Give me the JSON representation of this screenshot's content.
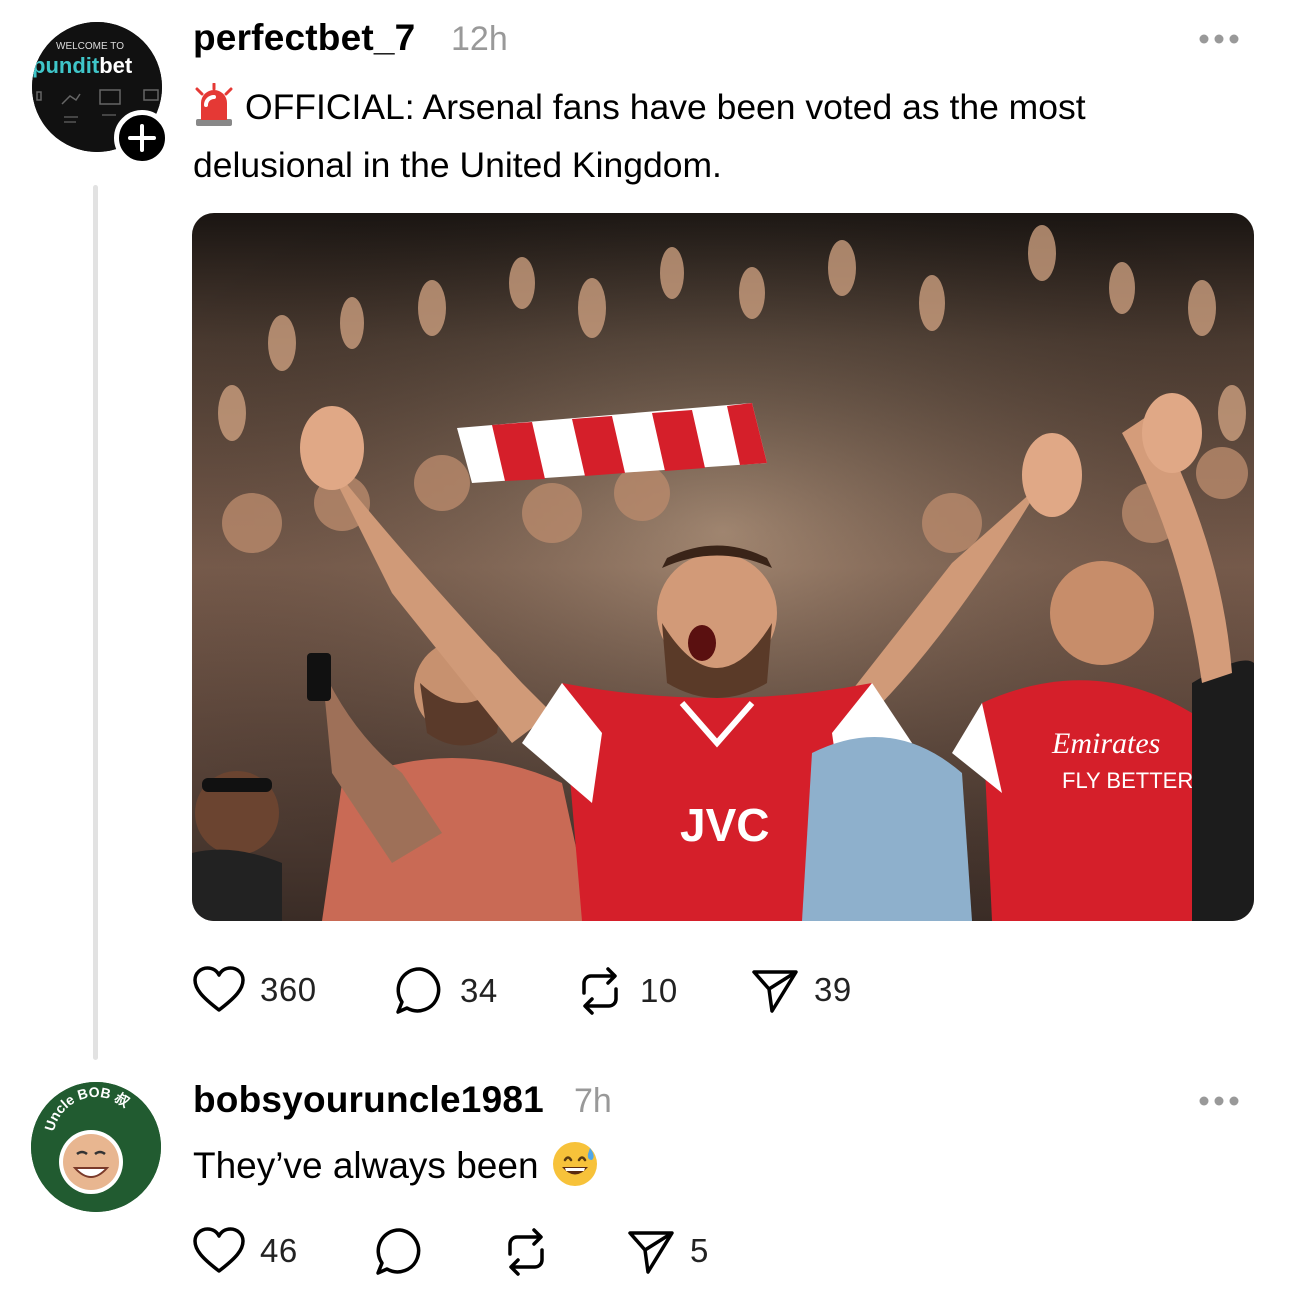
{
  "post": {
    "avatar": {
      "welcome": "WELCOME TO",
      "brand_part1": "pundit",
      "brand_part2": "bet",
      "icon": "punditbet-logo"
    },
    "username": "perfectbet_7",
    "time": "12h",
    "text": "OFFICIAL: Arsenal fans have been voted as the most delusional in the United Kingdom.",
    "emoji": "police-siren-emoji",
    "image": {
      "subject": "Arsenal fans cheering in stadium",
      "jersey_text": "JVC",
      "sponsor_text_1": "Emirates",
      "sponsor_text_2": "FLY BETTER"
    },
    "likes": "360",
    "replies": "34",
    "reposts": "10",
    "shares": "39"
  },
  "reply": {
    "avatar": {
      "label": "Uncle BOB 叔",
      "icon": "uncle-bob-avatar"
    },
    "username": "bobsyouruncle1981",
    "time": "7h",
    "text": "They’ve always been",
    "emoji": "grinning-sweat-emoji",
    "likes": "46",
    "shares": "5"
  },
  "colors": {
    "accent_cyan": "#3fc6c9",
    "arsenal_red": "#d51f2a",
    "meta_gray": "#999999",
    "thread_line": "#e2e2e2",
    "uncle_bob_green": "#215b30"
  }
}
